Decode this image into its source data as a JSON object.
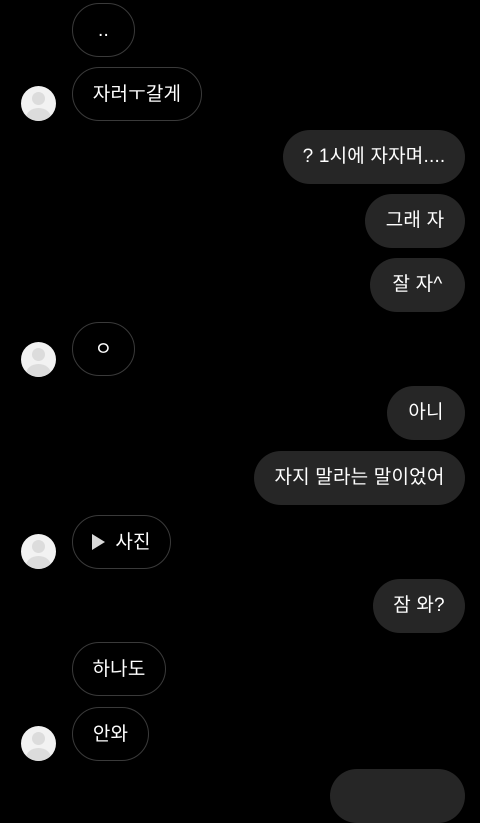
{
  "messages": [
    {
      "from": "them",
      "text": ".."
    },
    {
      "from": "them",
      "text": "자러ㅜ갈게"
    },
    {
      "from": "me",
      "text": "? 1시에 자자며...."
    },
    {
      "from": "me",
      "text": "그래 자"
    },
    {
      "from": "me",
      "text": "잘 자^"
    },
    {
      "from": "them",
      "text": "ㅇ"
    },
    {
      "from": "me",
      "text": "아니"
    },
    {
      "from": "me",
      "text": "자지 말라는 말이었어"
    },
    {
      "from": "them",
      "type": "photo",
      "text": "사진"
    },
    {
      "from": "me",
      "text": "잠 와?"
    },
    {
      "from": "them",
      "text": "하나도"
    },
    {
      "from": "them",
      "text": "안와"
    }
  ],
  "colors": {
    "background": "#000000",
    "sent_bubble": "#262626",
    "received_border": "#3a3a3a"
  }
}
